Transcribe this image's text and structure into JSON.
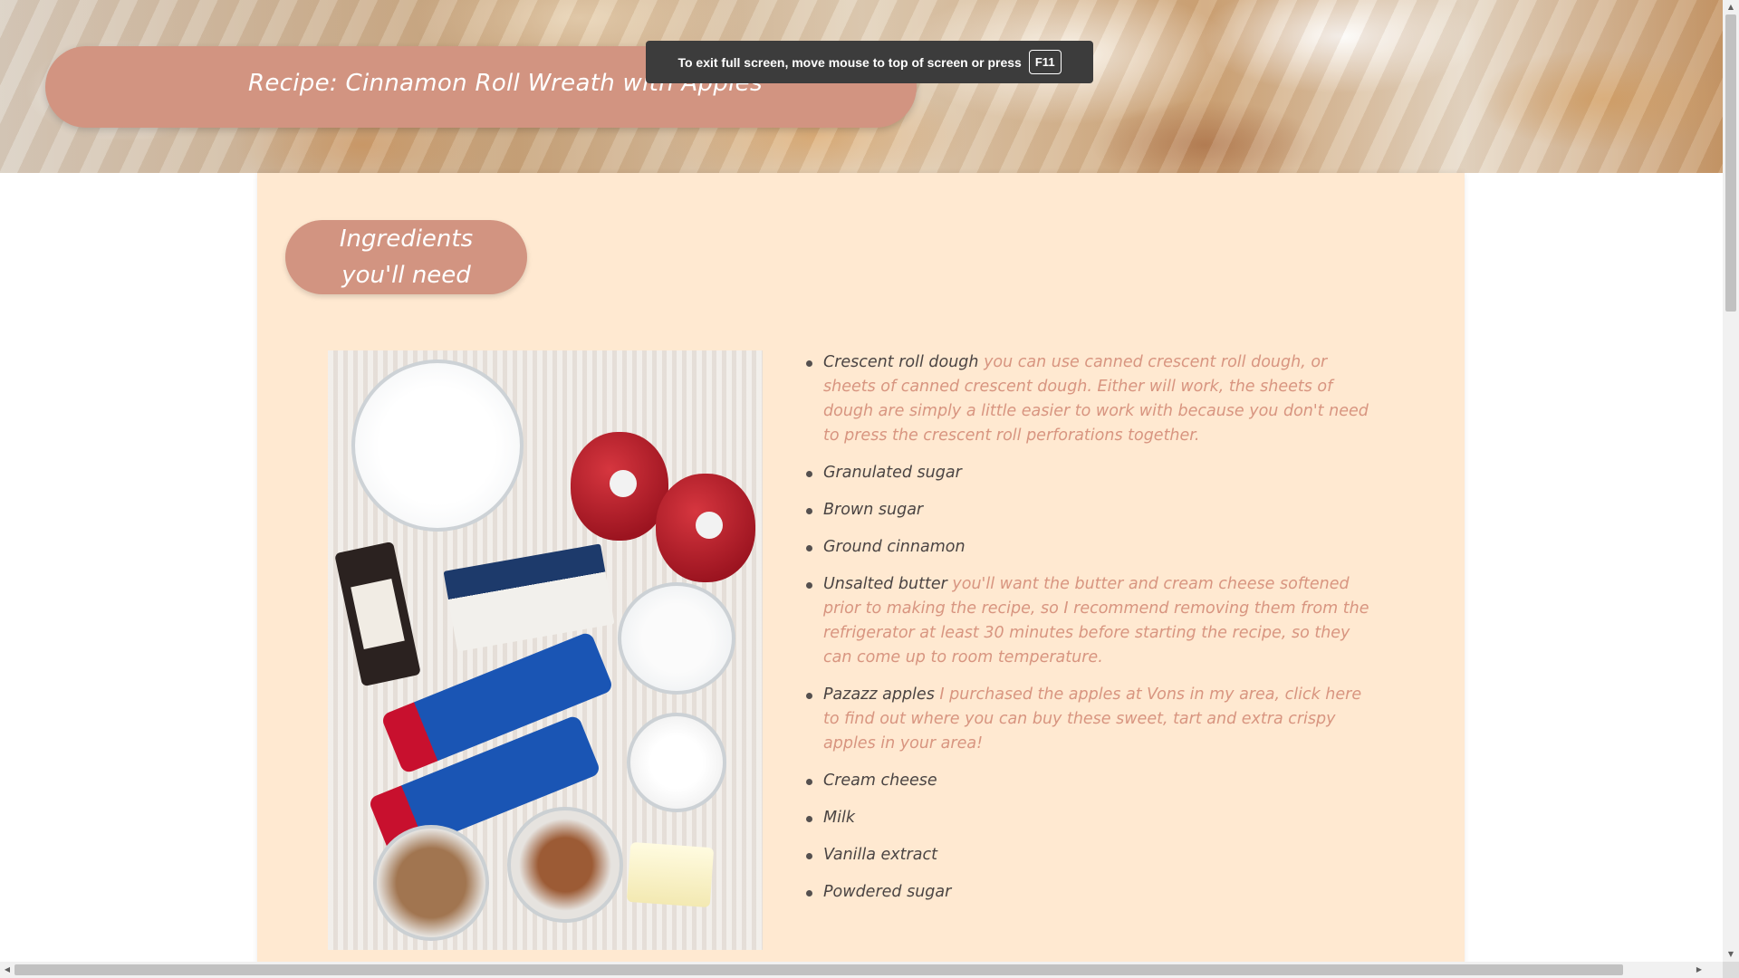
{
  "header": {
    "title": "Recipe: Cinnamon Roll Wreath with Apples"
  },
  "fullscreen_notice": {
    "text": "To exit full screen, move mouse to top of screen or press",
    "key": "F11"
  },
  "ingredients_section": {
    "heading": "Ingredients you'll need",
    "photo_name": "ingredients-photo",
    "items": [
      {
        "name": "Crescent roll dough",
        "note": "you can use canned crescent roll dough, or sheets of canned crescent dough. Either will work, the sheets of dough are simply a little easier to work with because you don't need to press the crescent roll perforations together."
      },
      {
        "name": "Granulated sugar",
        "note": ""
      },
      {
        "name": "Brown sugar",
        "note": ""
      },
      {
        "name": "Ground cinnamon",
        "note": ""
      },
      {
        "name": "Unsalted butter",
        "note": "you'll want the butter and cream cheese softened prior to making the recipe, so I recommend removing them from the refrigerator at least 30 minutes before starting the recipe, so they can come up to room temperature."
      },
      {
        "name": "Pazazz apples",
        "note": "I purchased the apples at Vons in my area, click here to find out where you can buy these sweet, tart and extra crispy apples in your area!"
      },
      {
        "name": "Cream cheese",
        "note": ""
      },
      {
        "name": "Milk",
        "note": ""
      },
      {
        "name": "Vanilla extract",
        "note": ""
      },
      {
        "name": "Powdered sugar",
        "note": ""
      }
    ]
  },
  "scrollbar": {
    "up_arrow": "▲",
    "down_arrow": "▼",
    "left_arrow": "◀",
    "right_arrow": "▶"
  },
  "colors": {
    "pill": "#d29481",
    "card_background": "#ffe9d1",
    "note_text": "#d89580",
    "name_text": "#4a4443"
  }
}
